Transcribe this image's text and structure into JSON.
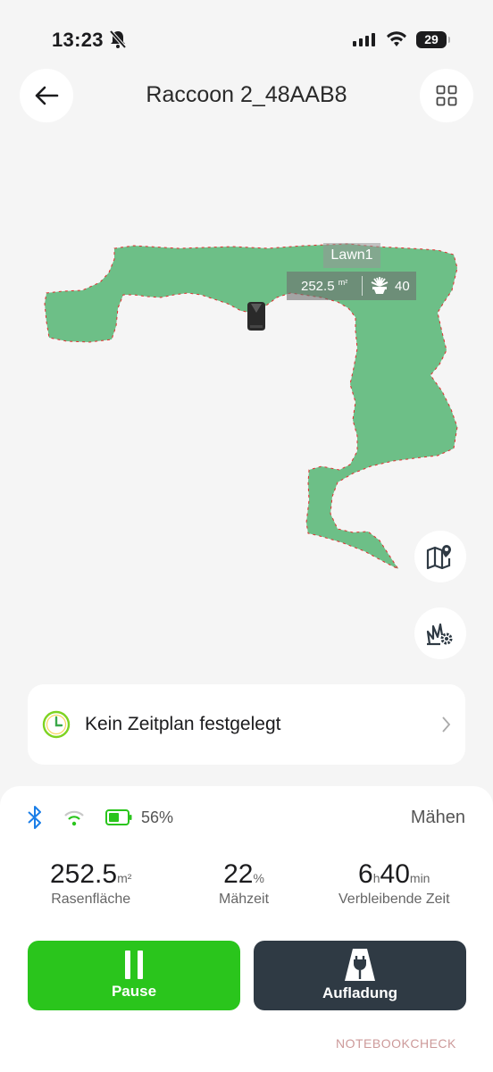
{
  "status_bar": {
    "time": "13:23",
    "battery": "29"
  },
  "header": {
    "title": "Raccoon 2_48AAB8"
  },
  "map": {
    "lawn_name": "Lawn1",
    "lawn_area": "252.5",
    "lawn_area_unit": "m²",
    "cut_height": "40",
    "lawn_color": "#6dbf87",
    "edge_color": "#e03030"
  },
  "schedule": {
    "text": "Kein Zeitplan festgelegt"
  },
  "panel": {
    "battery_percent": "56%",
    "mode": "Mähen",
    "stats": [
      {
        "value": "252.5",
        "unit": "m²",
        "label": "Rasenfläche"
      },
      {
        "value": "22",
        "unit": "%",
        "label": "Mähzeit"
      },
      {
        "value_h": "6",
        "unit_h": "h",
        "value_min": "40",
        "unit_min": "min",
        "label": "Verbleibende Zeit"
      }
    ],
    "pause_label": "Pause",
    "charge_label": "Aufladung"
  },
  "colors": {
    "accent_green": "#2ac51c",
    "dark_button": "#2f3a44",
    "bluetooth": "#1a7ee8"
  },
  "watermark": "NOTEBOOKCHECK"
}
